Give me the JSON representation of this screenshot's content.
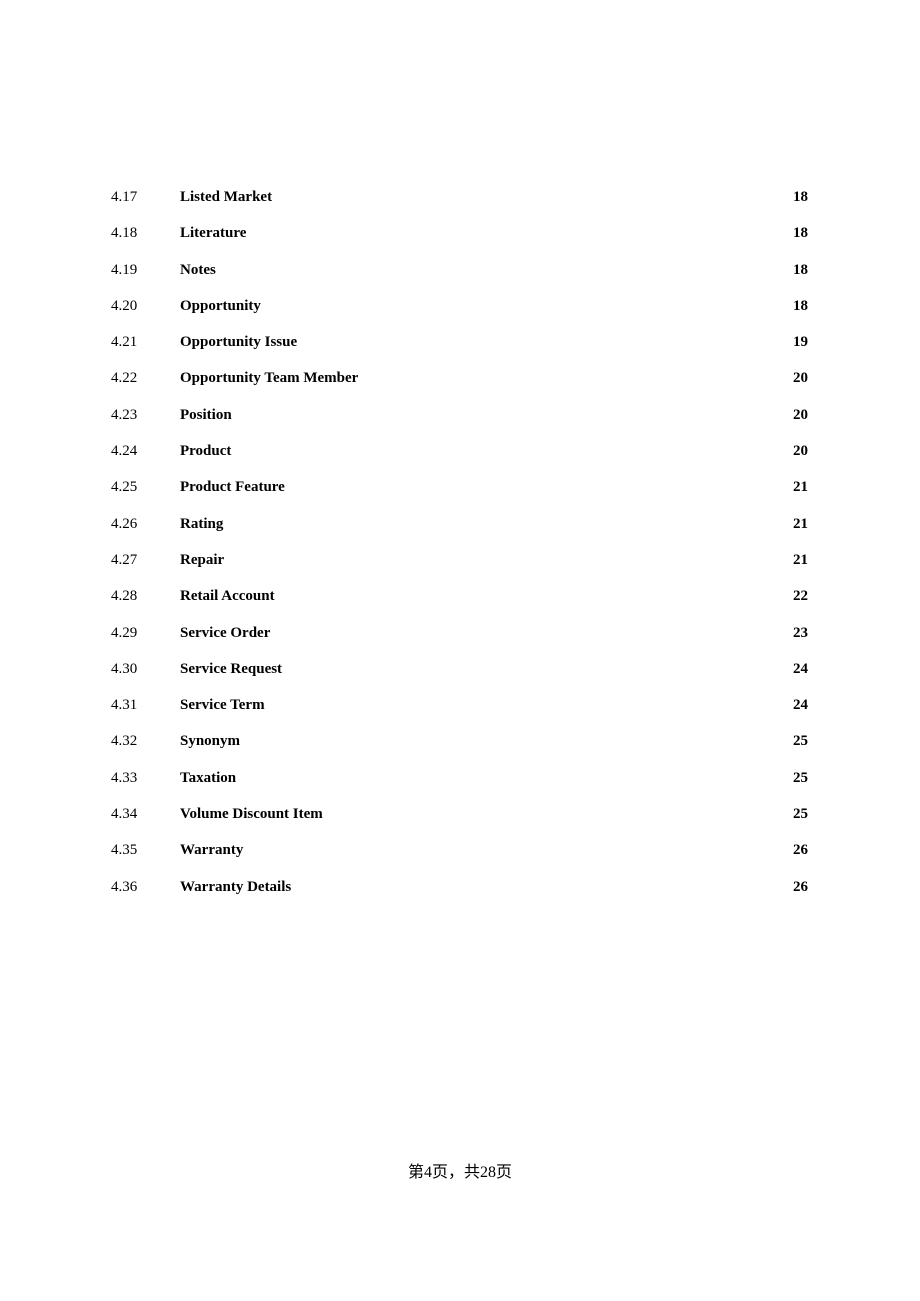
{
  "toc": {
    "entries": [
      {
        "number": "4.17",
        "title": "Listed Market",
        "page": "18"
      },
      {
        "number": "4.18",
        "title": "Literature",
        "page": "18"
      },
      {
        "number": "4.19",
        "title": "Notes",
        "page": "18"
      },
      {
        "number": "4.20",
        "title": "Opportunity",
        "page": "18"
      },
      {
        "number": "4.21",
        "title": "Opportunity Issue",
        "page": "19"
      },
      {
        "number": "4.22",
        "title": "Opportunity Team Member",
        "page": "20"
      },
      {
        "number": "4.23",
        "title": "Position",
        "page": "20"
      },
      {
        "number": "4.24",
        "title": "Product",
        "page": "20"
      },
      {
        "number": "4.25",
        "title": "Product Feature",
        "page": "21"
      },
      {
        "number": "4.26",
        "title": "Rating",
        "page": "21"
      },
      {
        "number": "4.27",
        "title": "Repair",
        "page": "21"
      },
      {
        "number": "4.28",
        "title": "Retail Account",
        "page": "22"
      },
      {
        "number": "4.29",
        "title": "Service Order",
        "page": "23"
      },
      {
        "number": "4.30",
        "title": "Service Request",
        "page": "24"
      },
      {
        "number": "4.31",
        "title": "Service Term",
        "page": "24"
      },
      {
        "number": "4.32",
        "title": "Synonym",
        "page": "25"
      },
      {
        "number": "4.33",
        "title": "Taxation",
        "page": "25"
      },
      {
        "number": "4.34",
        "title": "Volume Discount Item",
        "page": "25"
      },
      {
        "number": "4.35",
        "title": "Warranty",
        "page": "26"
      },
      {
        "number": "4.36",
        "title": "Warranty Details",
        "page": "26"
      }
    ]
  },
  "footer": {
    "page_label": "第4页，共28页"
  }
}
